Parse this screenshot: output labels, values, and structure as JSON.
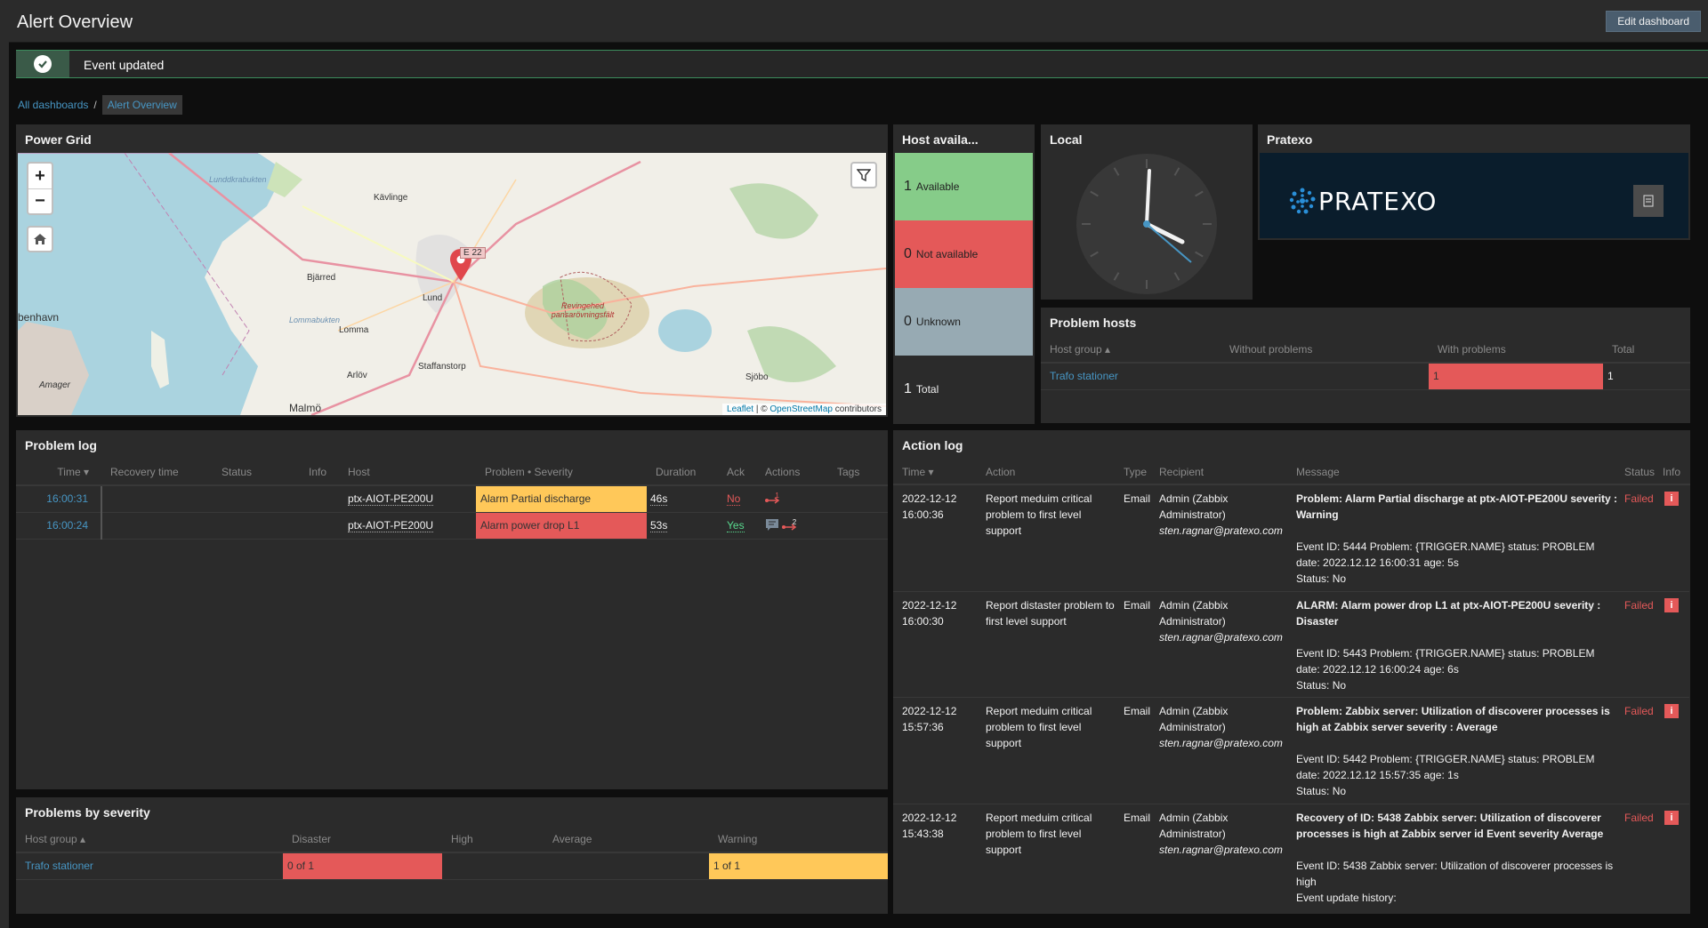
{
  "header": {
    "title": "Alert Overview",
    "edit_button": "Edit dashboard"
  },
  "message": {
    "text": "Event updated"
  },
  "breadcrumb": {
    "parent": "All dashboards",
    "separator": "/",
    "current": "Alert Overview"
  },
  "map_widget": {
    "title": "Power Grid",
    "zoom_in": "+",
    "zoom_out": "−",
    "marker_label": "E 22",
    "place_labels": [
      "Lunddkrabukten",
      "Kävlinge",
      "Bjärred",
      "Lund",
      "benhavn",
      "Lommabukten",
      "Lomma",
      "Staffanstorp",
      "Arlöv",
      "Amager",
      "Malmö",
      "Sjöbo",
      "Revingehed pansarövningsfält"
    ],
    "attribution_leaflet": "Leaflet",
    "attribution_sep": " | © ",
    "attribution_osm": "OpenStreetMap",
    "attribution_suffix": " contributors"
  },
  "host_avail": {
    "title": "Host availa...",
    "rows": [
      {
        "count": "1",
        "label": "Available",
        "color": "#86cc89"
      },
      {
        "count": "0",
        "label": "Not available",
        "color": "#e45959"
      },
      {
        "count": "0",
        "label": "Unknown",
        "color": "#97aab3"
      },
      {
        "count": "1",
        "label": "Total",
        "color": "#2b2b2b"
      }
    ]
  },
  "clock": {
    "title": "Local",
    "time_shown": "3:58"
  },
  "logo_widget": {
    "title": "Pratexo",
    "logo_text": "PRATEXO"
  },
  "problem_hosts": {
    "title": "Problem hosts",
    "columns": [
      "Host group ▴",
      "Without problems",
      "With problems",
      "Total"
    ],
    "rows": [
      {
        "group": "Trafo stationer",
        "without": "",
        "with": "1",
        "total": "1"
      }
    ]
  },
  "problem_log": {
    "title": "Problem log",
    "columns": [
      "Time ▾",
      "Recovery time",
      "Status",
      "Info",
      "Host",
      "Problem • Severity",
      "Duration",
      "Ack",
      "Actions",
      "Tags"
    ],
    "rows": [
      {
        "time": "16:00:31",
        "recovery": "",
        "status": "",
        "info": "",
        "host": "ptx-AIOT-PE200U",
        "problem": "Alarm Partial discharge",
        "severity": "warning",
        "duration": "46s",
        "ack": "No",
        "actions_count": "1"
      },
      {
        "time": "16:00:24",
        "recovery": "",
        "status": "",
        "info": "",
        "host": "ptx-AIOT-PE200U",
        "problem": "Alarm power drop L1",
        "severity": "disaster",
        "duration": "53s",
        "ack": "Yes",
        "actions_count": "2"
      }
    ]
  },
  "problems_by_severity": {
    "title": "Problems by severity",
    "columns": [
      "Host group ▴",
      "Disaster",
      "High",
      "Average",
      "Warning"
    ],
    "rows": [
      {
        "group": "Trafo stationer",
        "disaster": "0 of 1",
        "high": "",
        "average": "",
        "warning": "1 of 1"
      }
    ]
  },
  "action_log": {
    "title": "Action log",
    "columns": [
      "Time ▾",
      "Action",
      "Type",
      "Recipient",
      "Message",
      "Status",
      "Info"
    ],
    "rows": [
      {
        "date": "2022-12-12",
        "time": "16:00:36",
        "action": "Report meduim critical problem to first level support",
        "type": "Email",
        "recipient_name": "Admin (Zabbix Administrator)",
        "recipient_email": "sten.ragnar@pratexo.com",
        "subject": "Problem: Alarm Partial discharge at ptx-AIOT-PE200U severity : Warning",
        "body": "Event ID: 5444 Problem: {TRIGGER.NAME} status: PROBLEM date: 2022.12.12 16:00:31 age: 5s",
        "status_line": "Status: No",
        "status": "Failed",
        "info": "i"
      },
      {
        "date": "2022-12-12",
        "time": "16:00:30",
        "action": "Report distaster problem to first level support",
        "type": "Email",
        "recipient_name": "Admin (Zabbix Administrator)",
        "recipient_email": "sten.ragnar@pratexo.com",
        "subject": "ALARM: Alarm power drop L1 at ptx-AIOT-PE200U severity : Disaster",
        "body": "Event ID: 5443 Problem: {TRIGGER.NAME} status: PROBLEM date: 2022.12.12 16:00:24 age: 6s",
        "status_line": "Status: No",
        "status": "Failed",
        "info": "i"
      },
      {
        "date": "2022-12-12",
        "time": "15:57:36",
        "action": "Report meduim critical problem to first level support",
        "type": "Email",
        "recipient_name": "Admin (Zabbix Administrator)",
        "recipient_email": "sten.ragnar@pratexo.com",
        "subject": "Problem: Zabbix server: Utilization of discoverer processes is high at Zabbix server severity : Average",
        "body": "Event ID: 5442 Problem: {TRIGGER.NAME} status: PROBLEM date: 2022.12.12 15:57:35 age: 1s",
        "status_line": "Status: No",
        "status": "Failed",
        "info": "i"
      },
      {
        "date": "2022-12-12",
        "time": "15:43:38",
        "action": "Report meduim critical problem to first level support",
        "type": "Email",
        "recipient_name": "Admin (Zabbix Administrator)",
        "recipient_email": "sten.ragnar@pratexo.com",
        "subject": "Recovery of ID: 5438 Zabbix server: Utilization of discoverer processes is high at Zabbix server id Event severity Average",
        "body": "Event ID: 5438 Zabbix server: Utilization of discoverer processes is high",
        "status_line": "Event update history:",
        "status": "Failed",
        "info": "i"
      }
    ]
  }
}
